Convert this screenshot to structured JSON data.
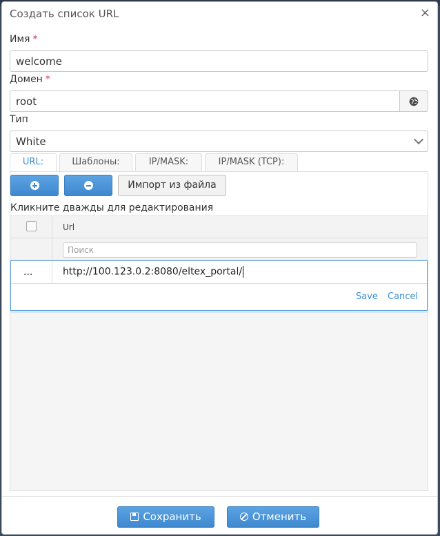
{
  "dialog": {
    "title": "Создать список URL",
    "close": "×"
  },
  "form": {
    "name_label": "Имя",
    "name_value": "welcome",
    "domain_label": "Домен",
    "domain_value": "root",
    "type_label": "Тип",
    "type_value": "White",
    "required_mark": "*"
  },
  "tabs": [
    {
      "label": "URL:"
    },
    {
      "label": "Шаблоны:"
    },
    {
      "label": "IP/MASK:"
    },
    {
      "label": "IP/MASK (TCP):"
    }
  ],
  "toolbar": {
    "import_label": "Импорт из файла"
  },
  "grid": {
    "hint": "Кликните дважды для редактирования",
    "column_url": "Url",
    "filter_placeholder": "Поиск",
    "edit_row": {
      "dots": "...",
      "value": "http://100.123.0.2:8080/eltex_portal/"
    },
    "save_label": "Save",
    "cancel_label": "Cancel"
  },
  "footer": {
    "save_label": "Сохранить",
    "cancel_label": "Отменить"
  },
  "colors": {
    "accent": "#3f8fd2",
    "required": "#d9304f"
  }
}
